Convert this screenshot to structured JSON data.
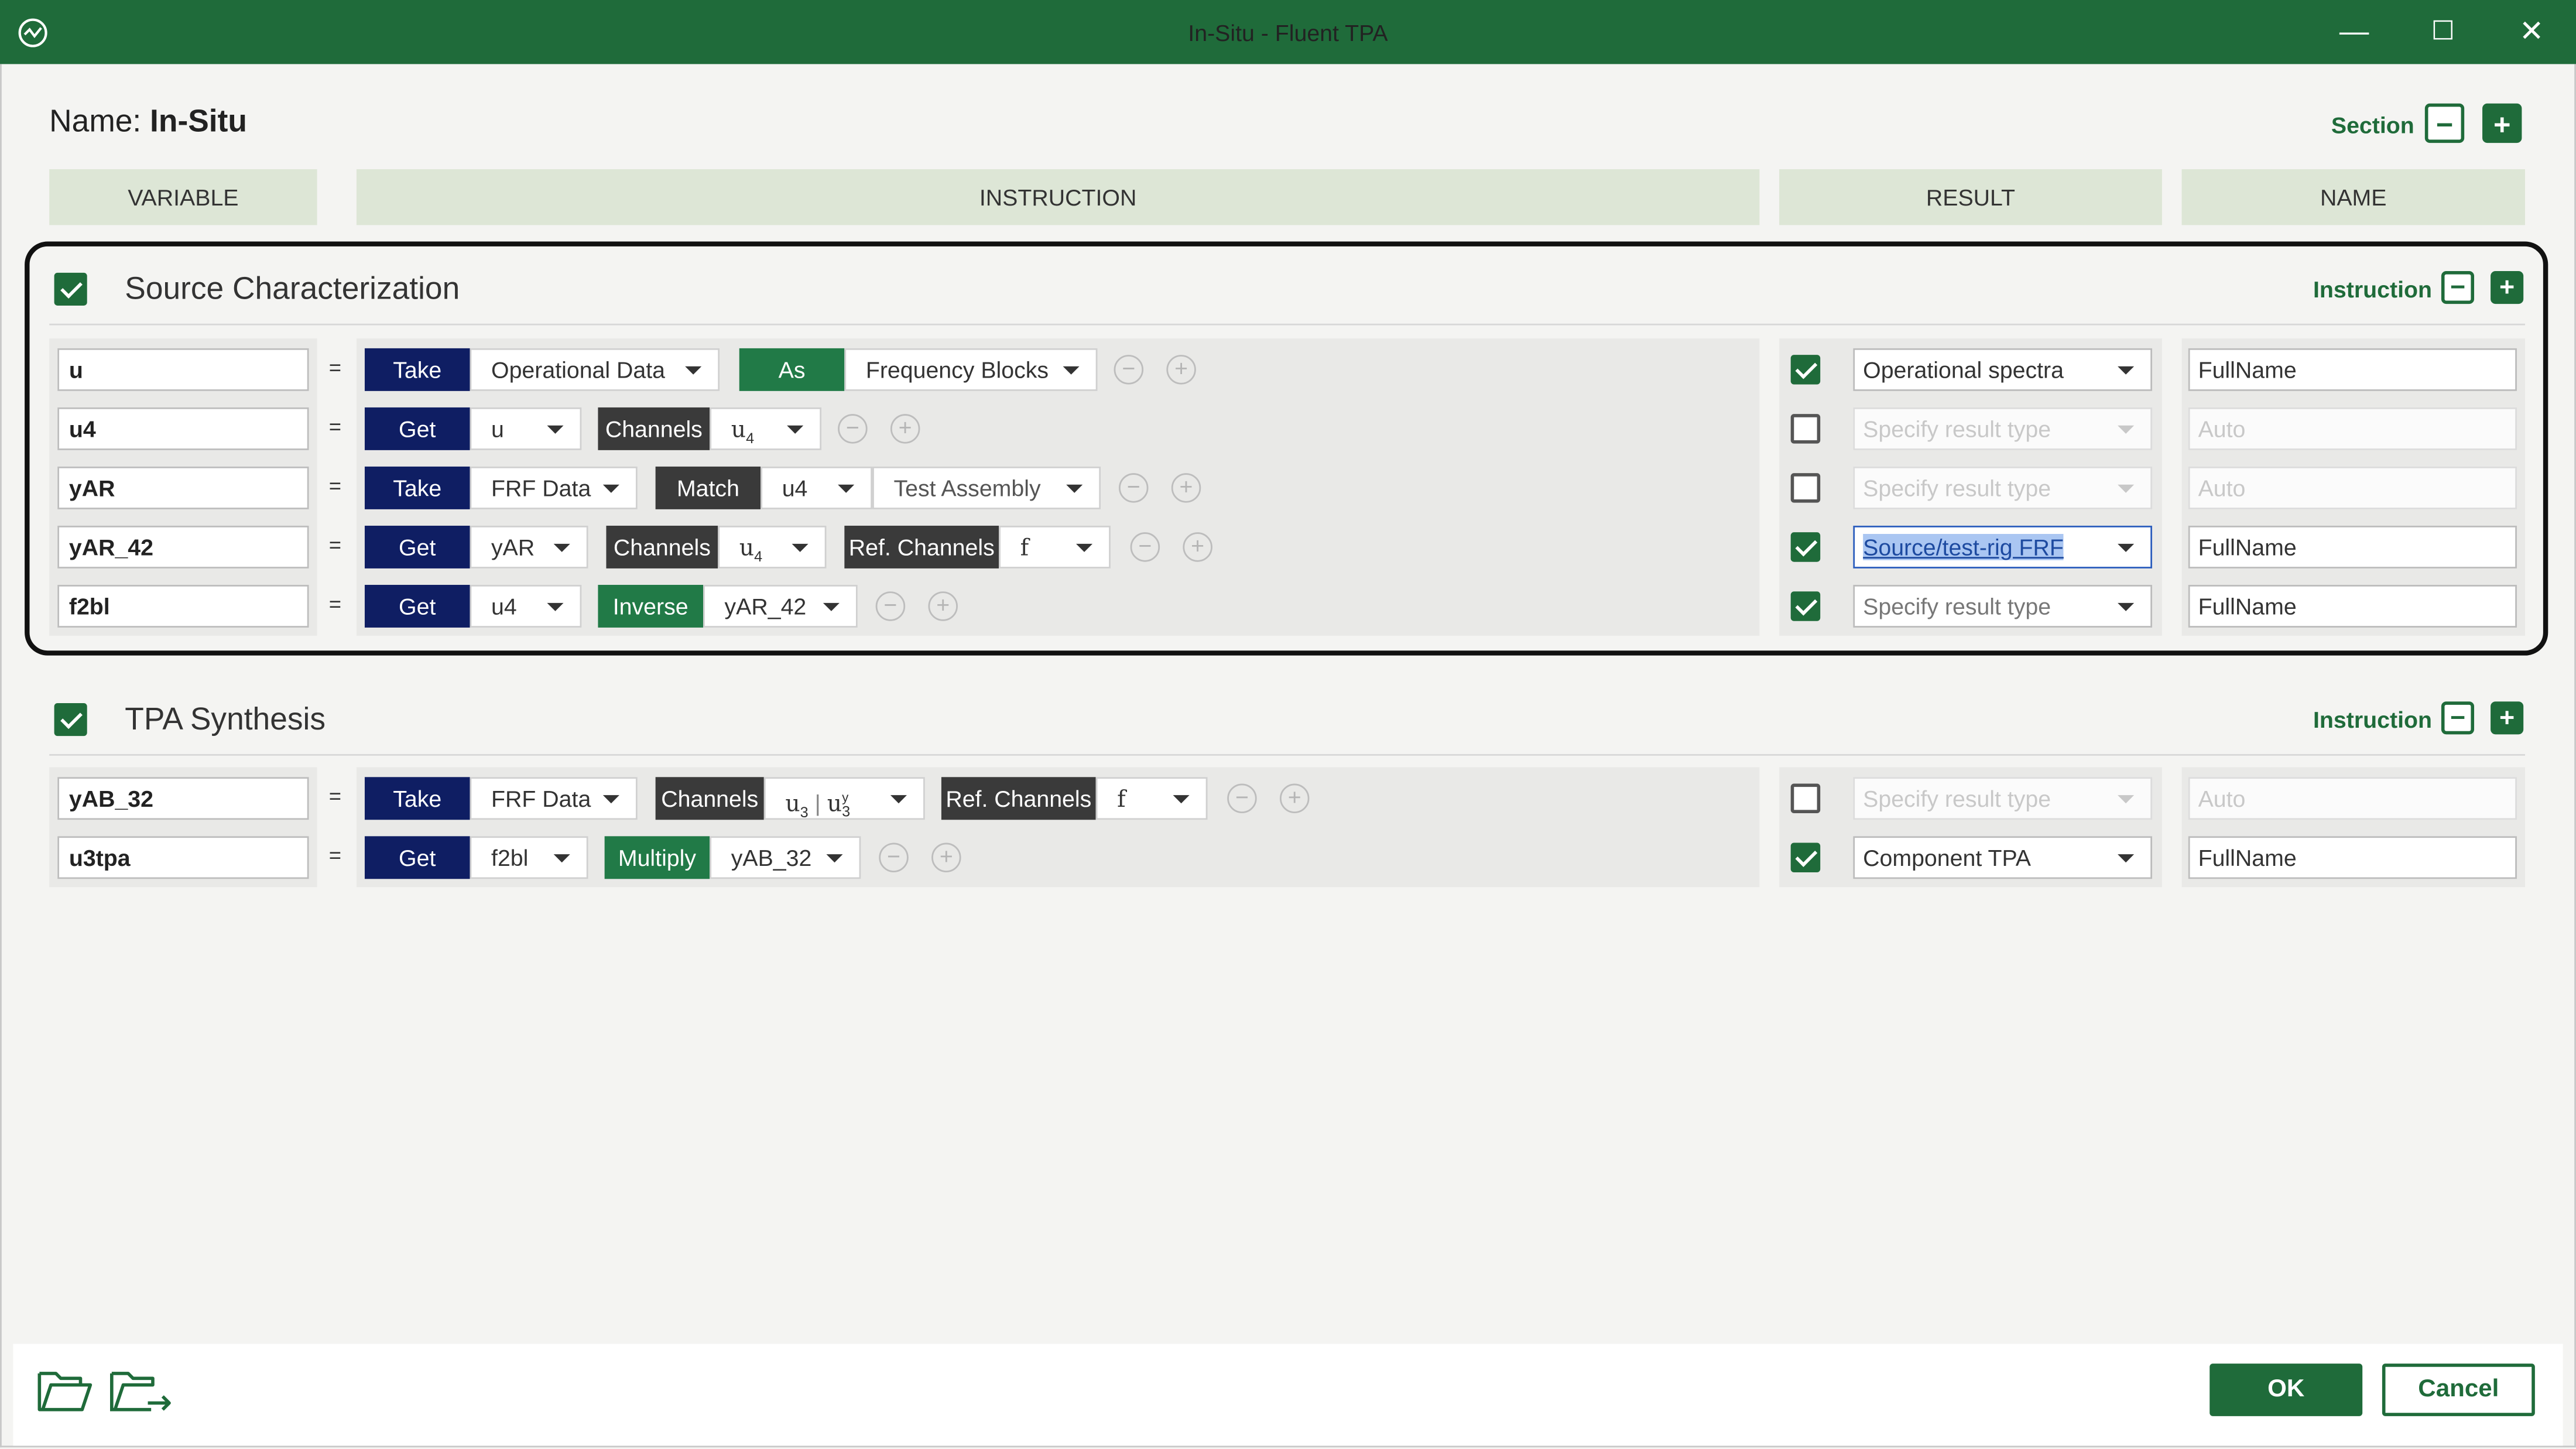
{
  "window": {
    "title": "In-Situ - Fluent TPA",
    "minimize": "—",
    "maximize": "☐",
    "close": "✕"
  },
  "name": {
    "label": "Name:",
    "value": "In-Situ"
  },
  "section_controls": {
    "label": "Section",
    "remove": "−",
    "add": "+"
  },
  "columns": {
    "variable": "VARIABLE",
    "instruction": "INSTRUCTION",
    "result": "RESULT",
    "name": "NAME"
  },
  "sections": [
    {
      "title": "Source Characterization",
      "checked": true,
      "instruction_label": "Instruction",
      "rows": [
        {
          "var": "u",
          "eq": "=",
          "parts": [
            "Take",
            "Operational Data",
            "As",
            "Frequency Blocks"
          ],
          "result_checked": true,
          "result": "Operational spectra",
          "name": "FullName"
        },
        {
          "var": "u4",
          "eq": "=",
          "parts": [
            "Get",
            "u",
            "Channels",
            "u",
            "4"
          ],
          "result_checked": false,
          "result": "Specify result type",
          "name": "Auto"
        },
        {
          "var": "yAR",
          "eq": "=",
          "parts": [
            "Take",
            "FRF Data",
            "Match",
            "u4",
            "Test Assembly"
          ],
          "result_checked": false,
          "result": "Specify result type",
          "name": "Auto"
        },
        {
          "var": "yAR_42",
          "eq": "=",
          "parts": [
            "Get",
            "yAR",
            "Channels",
            "u",
            "4",
            "Ref. Channels",
            "f"
          ],
          "result_checked": true,
          "result": "Source/test-rig FRF",
          "name": "FullName"
        },
        {
          "var": "f2bl",
          "eq": "=",
          "parts": [
            "Get",
            "u4",
            "Inverse",
            "yAR_42"
          ],
          "result_checked": true,
          "result": "Specify result type",
          "name": "FullName"
        }
      ]
    },
    {
      "title": "TPA Synthesis",
      "checked": true,
      "instruction_label": "Instruction",
      "rows": [
        {
          "var": "yAB_32",
          "eq": "=",
          "parts": [
            "Take",
            "FRF Data",
            "Channels",
            "u",
            "3",
            "|",
            "u",
            "y",
            "3",
            "Ref. Channels",
            "f"
          ],
          "result_checked": false,
          "result": "Specify result type",
          "name": "Auto"
        },
        {
          "var": "u3tpa",
          "eq": "=",
          "parts": [
            "Get",
            "f2bl",
            "Multiply",
            "yAB_32"
          ],
          "result_checked": true,
          "result": "Component TPA",
          "name": "FullName"
        }
      ]
    }
  ],
  "icons": {
    "remove_row": "−",
    "add_row": "+"
  },
  "footer": {
    "ok": "OK",
    "cancel": "Cancel"
  },
  "colors": {
    "brand_green": "#1f6b3a",
    "navy": "#0f1e63",
    "header_bg": "#dde6d6"
  }
}
